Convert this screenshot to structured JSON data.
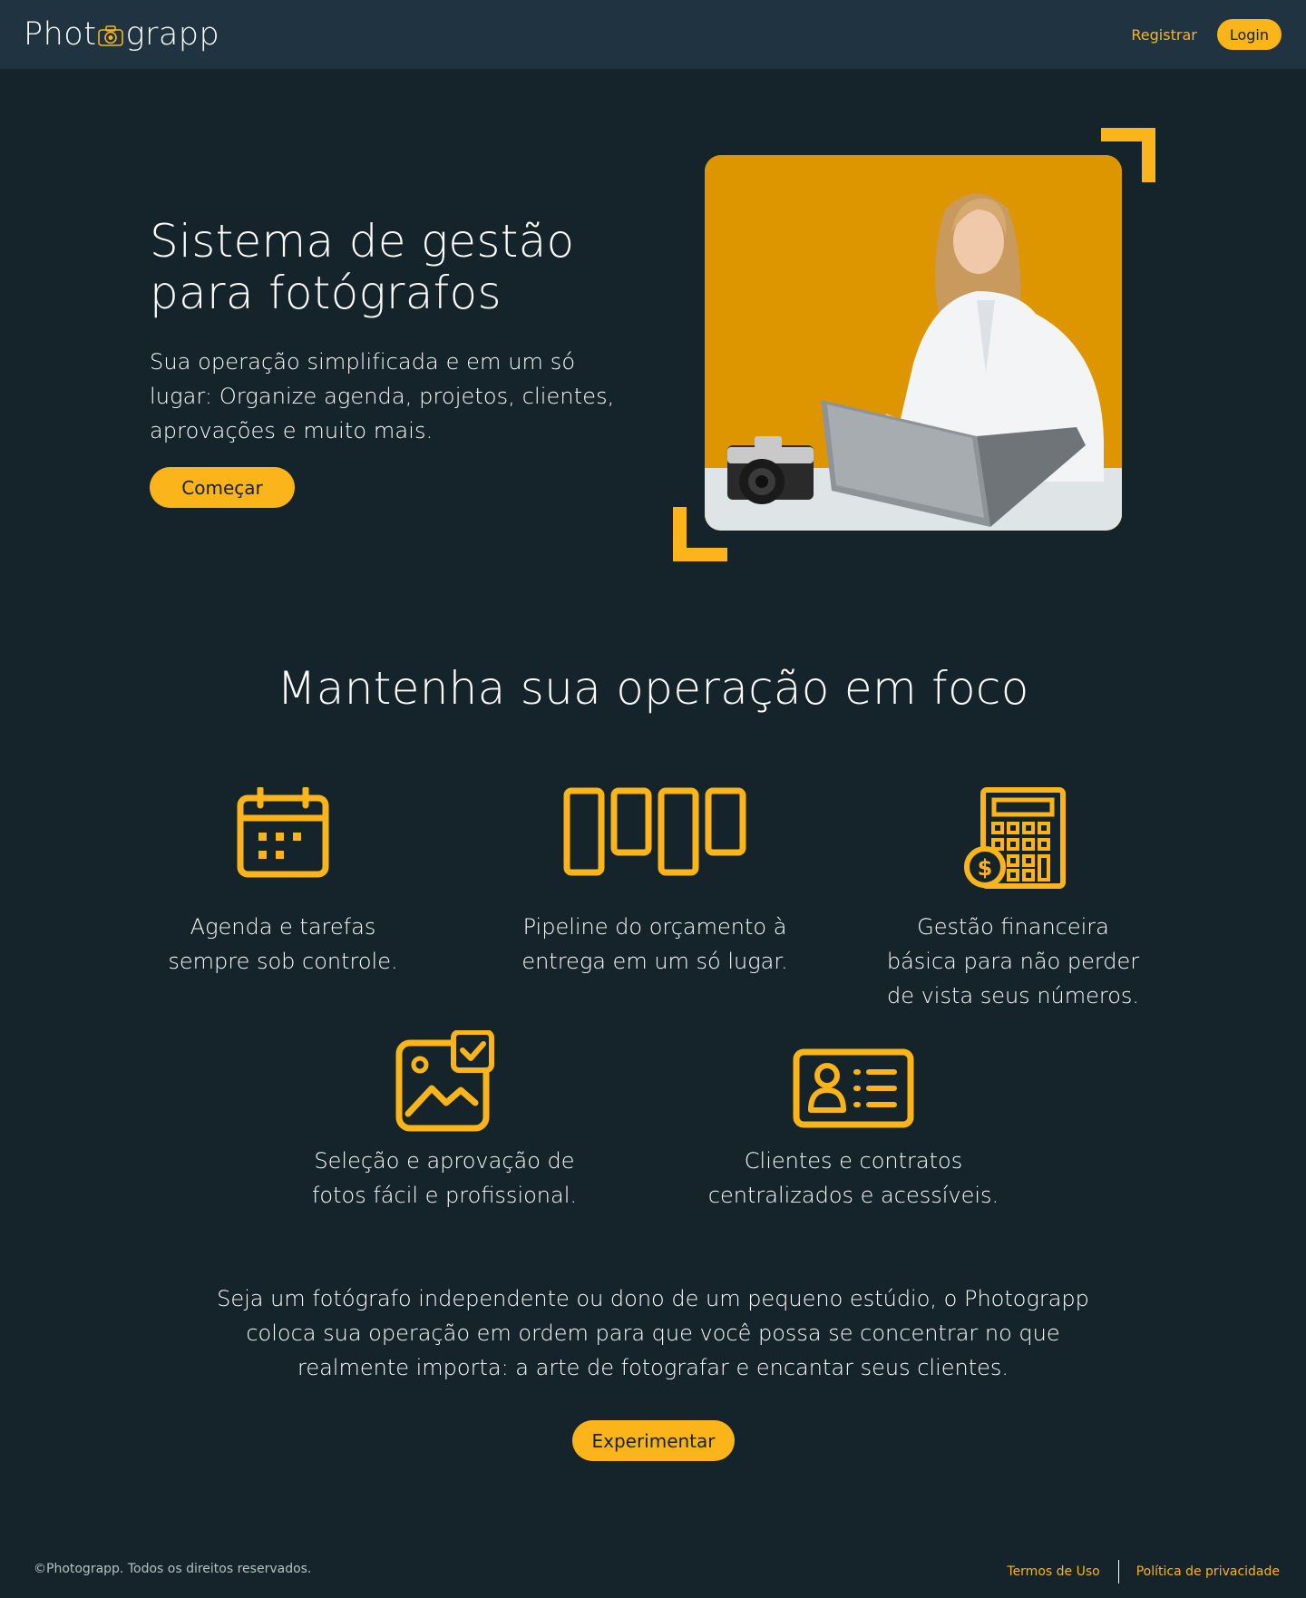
{
  "header": {
    "logo_left": "Phot",
    "logo_right": "grapp",
    "register_label": "Registrar",
    "login_label": "Login"
  },
  "hero": {
    "title": "Sistema de gestão\npara fotógrafos",
    "subtitle": "Sua operação simplificada e em um só lugar: Organize agenda, projetos, clientes, aprovações e muito mais.",
    "cta_label": "Começar"
  },
  "features": {
    "title": "Mantenha sua operação em foco",
    "items": [
      {
        "icon": "calendar-icon",
        "text": "Agenda e tarefas\nsempre sob controle."
      },
      {
        "icon": "pipeline-icon",
        "text": "Pipeline do orçamento à\nentrega em um só lugar."
      },
      {
        "icon": "calculator-icon",
        "text": "Gestão financeira\nbásica para não perder\nde vista seus números."
      },
      {
        "icon": "photo-approval-icon",
        "text": "Seleção e aprovação de\nfotos fácil e profissional."
      },
      {
        "icon": "contact-card-icon",
        "text": "Clientes e contratos\ncentralizados e acessíveis."
      }
    ]
  },
  "closing": {
    "text": "Seja um fotógrafo independente ou dono de um pequeno estúdio, o Photograpp\ncoloca sua operação em ordem para que você possa se concentrar no que\nrealmente importa: a arte de fotografar e encantar seus clientes.",
    "cta_label": "Experimentar"
  },
  "footer": {
    "copyright": "©Photograpp. Todos os direitos reservados.",
    "terms_label": "Termos de Uso",
    "privacy_label": "Política de privacidade"
  },
  "colors": {
    "background": "#15232b",
    "header": "#1f3440",
    "accent": "#fbb41a",
    "photo_bg": "#de9600"
  }
}
